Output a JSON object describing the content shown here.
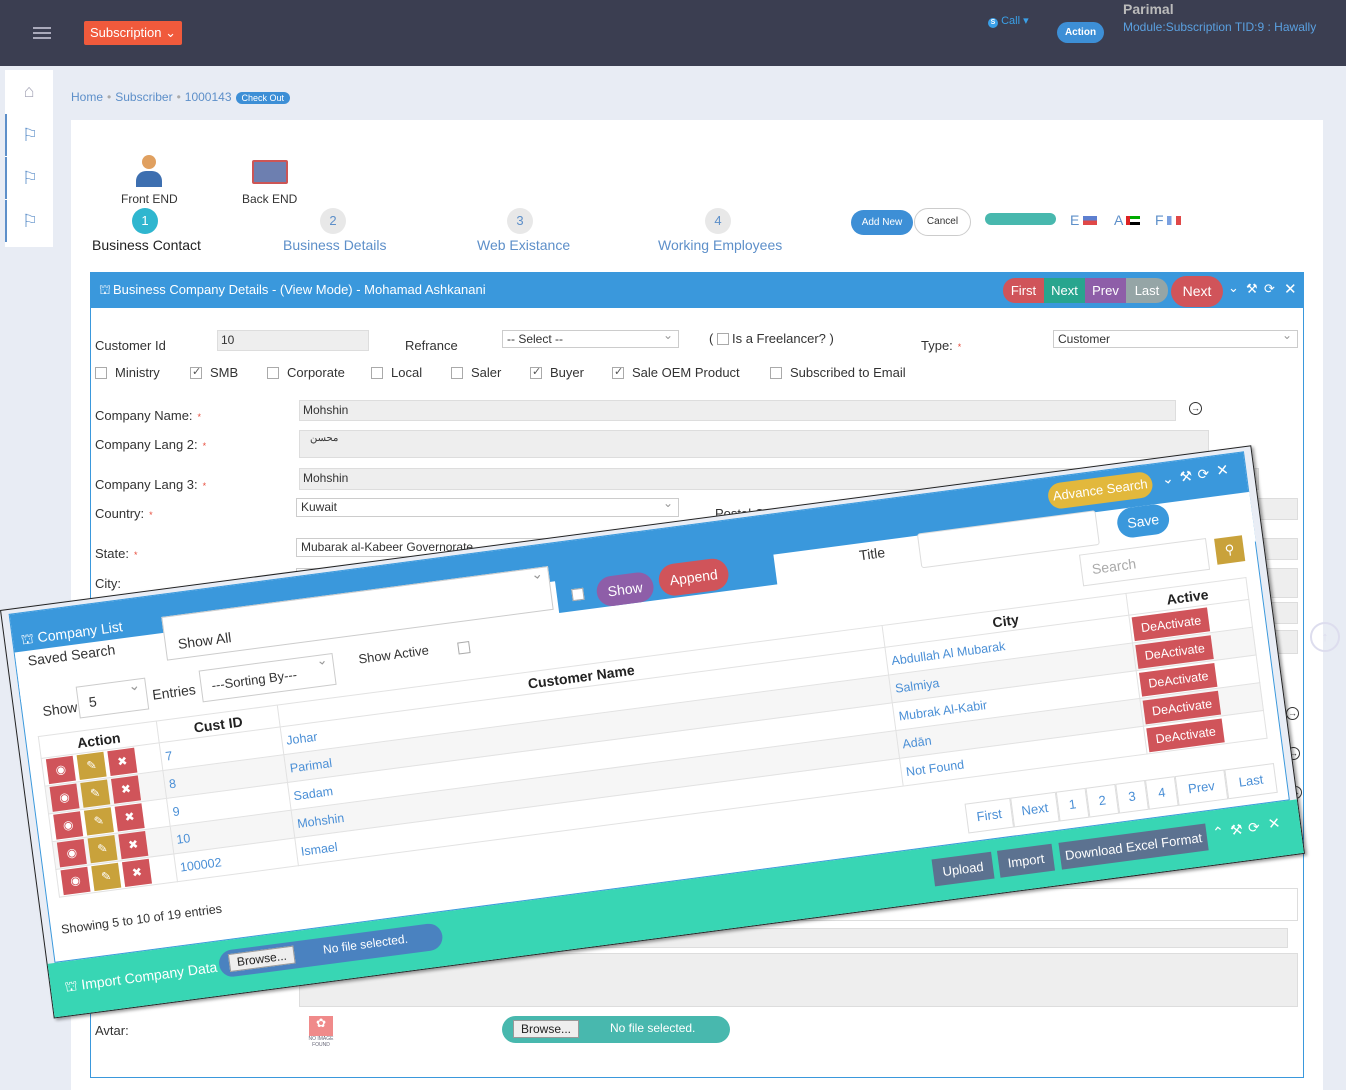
{
  "topbar": {
    "subscription_label": "Subscription ⌄",
    "call_label": "Call ▾",
    "action_label": "Action",
    "user_name": "Parimal",
    "module_info": "Module:Subscription  TID:9 : Hawally"
  },
  "sidebar": {
    "items": [
      {
        "icon": "home-icon"
      },
      {
        "icon": "flag-icon"
      },
      {
        "icon": "flag-icon"
      },
      {
        "icon": "flag-icon"
      }
    ]
  },
  "breadcrumb": {
    "items": [
      "Home",
      "Subscriber",
      "1000143"
    ],
    "badge": "Check Out"
  },
  "wizard": {
    "icons": [
      {
        "label": "Front END",
        "icon": "user-icon"
      },
      {
        "label": "Back END",
        "icon": "card-icon"
      }
    ],
    "steps": [
      {
        "num": "1",
        "label": "Business Contact",
        "active": true
      },
      {
        "num": "2",
        "label": "Business Details"
      },
      {
        "num": "3",
        "label": "Web Existance"
      },
      {
        "num": "4",
        "label": "Working Employees"
      }
    ],
    "add_new": "Add New",
    "cancel": "Cancel",
    "languages": [
      "E",
      "A",
      "F"
    ]
  },
  "panel": {
    "title": "Business Company Details - (View Mode) - Mohamad Ashkanani",
    "nav": [
      "First",
      "Next",
      "Prev",
      "Last"
    ],
    "next": "Next"
  },
  "form": {
    "customer_id_label": "Customer Id",
    "customer_id": "10",
    "refrance_label": "Refrance",
    "refrance_value": "-- Select --",
    "freelancer_open": "(",
    "freelancer_label": "Is a Freelancer? )",
    "type_label": "Type:",
    "type_value": "Customer",
    "checkboxes": [
      {
        "label": "Ministry",
        "checked": false
      },
      {
        "label": "SMB",
        "checked": true
      },
      {
        "label": "Corporate",
        "checked": false
      },
      {
        "label": "Local",
        "checked": false
      },
      {
        "label": "Saler",
        "checked": false
      },
      {
        "label": "Buyer",
        "checked": true
      },
      {
        "label": "Sale OEM Product",
        "checked": true
      },
      {
        "label": "Subscribed to Email",
        "checked": false
      }
    ],
    "company_name_label": "Company Name:",
    "company_name": "Mohshin",
    "lang2_label": "Company Lang 2:",
    "lang2": "محسن",
    "lang3_label": "Company Lang 3:",
    "lang3": "Mohshin",
    "country_label": "Country:",
    "country": "Kuwait",
    "postal_label": "Postal Code",
    "state_label": "State:",
    "state": "Mubarak al-Kabeer Governorate",
    "city_label": "City:",
    "avatar_label": "Avtar:",
    "avatar_placeholder": "NO IMAGE FOUND",
    "browse": "Browse...",
    "no_file": "No file selected."
  },
  "company_list": {
    "title": "Company List",
    "saved_search_label": "Saved Search",
    "saved_search_value": "Show All",
    "show_btn": "Show",
    "append_btn": "Append",
    "title_label": "Title",
    "save_btn": "Save",
    "advance_search": "Advance Search",
    "search_placeholder": "Search",
    "show_active_label": "Show Active",
    "show_label": "Show",
    "entries_value": "5",
    "entries_label": "Entries",
    "sorting": "---Sorting By---",
    "columns": [
      "Action",
      "Cust ID",
      "Customer Name",
      "City",
      "Active"
    ],
    "rows": [
      {
        "id": "7",
        "name": "Johar",
        "city": "Abdullah Al Mubarak",
        "active": "DeActivate"
      },
      {
        "id": "8",
        "name": "Parimal",
        "city": "Salmiya",
        "active": "DeActivate"
      },
      {
        "id": "9",
        "name": "Sadam",
        "city": "Mubrak Al-Kabir",
        "active": "DeActivate"
      },
      {
        "id": "10",
        "name": "Mohshin",
        "city": "Adān",
        "active": "DeActivate"
      },
      {
        "id": "100002",
        "name": "Ismael",
        "city": "Not Found",
        "active": "DeActivate"
      }
    ],
    "pagination": [
      "First",
      "Next",
      "1",
      "2",
      "3",
      "4",
      "Prev",
      "Last"
    ],
    "showing": "Showing 5 to 10 of 19 entries"
  },
  "import": {
    "title": "Import Company Data",
    "browse": "Browse...",
    "no_file": "No file selected.",
    "upload": "Upload",
    "import": "Import",
    "download": "Download Excel Format"
  },
  "colors": {
    "topbar": "#3b3e51",
    "primary": "#3a98dc",
    "danger": "#d0545a",
    "teal": "#38d6b4",
    "warning": "#c9a23b",
    "purple": "#8e5ea8"
  }
}
